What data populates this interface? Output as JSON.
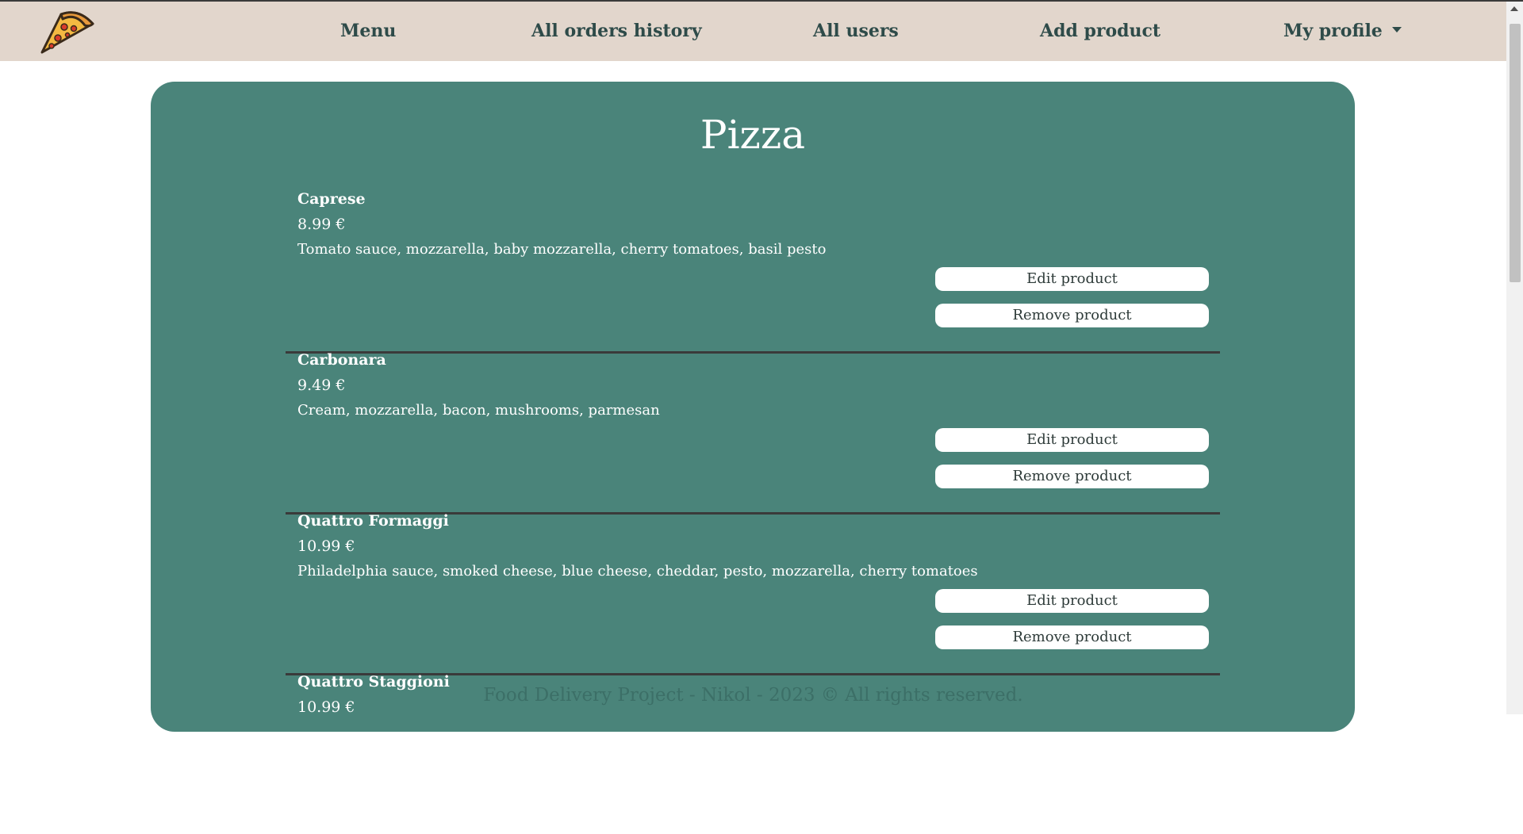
{
  "nav": {
    "items": [
      {
        "label": "Menu"
      },
      {
        "label": "All orders history"
      },
      {
        "label": "All users"
      },
      {
        "label": "Add product"
      }
    ],
    "profile_label": "My profile",
    "logo_icon": "pizza-slice-icon"
  },
  "colors": {
    "navbar_bg": "#e2d6cc",
    "panel_bg": "#4a847a",
    "text_dark": "#2e4b49"
  },
  "section": {
    "title": "Pizza"
  },
  "products": [
    {
      "name": "Caprese",
      "price": "8.99 €",
      "description": "Tomato sauce, mozzarella, baby mozzarella, cherry tomatoes, basil pesto",
      "edit_label": "Edit product",
      "remove_label": "Remove product"
    },
    {
      "name": "Carbonara",
      "price": "9.49 €",
      "description": "Cream, mozzarella, bacon, mushrooms, parmesan",
      "edit_label": "Edit product",
      "remove_label": "Remove product"
    },
    {
      "name": "Quattro Formaggi",
      "price": "10.99 €",
      "description": "Philadelphia sauce, smoked cheese, blue cheese, cheddar, pesto, mozzarella, cherry tomatoes",
      "edit_label": "Edit product",
      "remove_label": "Remove product"
    },
    {
      "name": "Quattro Staggioni",
      "price": "10.99 €",
      "description": "",
      "edit_label": "",
      "remove_label": ""
    }
  ],
  "footer": {
    "text": "Food Delivery Project - Nikol - 2023 © All rights reserved."
  }
}
